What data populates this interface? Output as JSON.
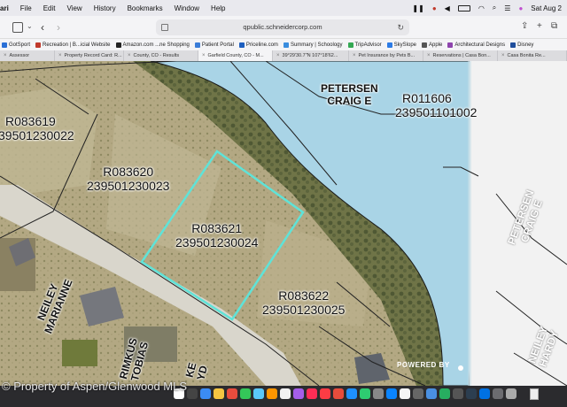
{
  "menubar": {
    "app": "ari",
    "items": [
      "File",
      "Edit",
      "View",
      "History",
      "Bookmarks",
      "Window",
      "Help"
    ],
    "clock": "Sat Aug 2"
  },
  "toolbar": {
    "url": "qpublic.schneidercorp.com"
  },
  "bookmarks": [
    {
      "label": "GotSport",
      "color": "#2a6fd6"
    },
    {
      "label": "Recreation | B...icial Website",
      "color": "#c0392b"
    },
    {
      "label": "Amazon.com ...ne Shopping",
      "color": "#222222"
    },
    {
      "label": "Patient Portal",
      "color": "#3b7dd8"
    },
    {
      "label": "Priceline.com",
      "color": "#1d5fbf"
    },
    {
      "label": "Summary | Schoology",
      "color": "#3a8dde"
    },
    {
      "label": "TripAdvisor",
      "color": "#34a853"
    },
    {
      "label": "SkySlope",
      "color": "#2c7be5"
    },
    {
      "label": "Apple",
      "color": "#555555"
    },
    {
      "label": "Architectural Designs",
      "color": "#8e44ad"
    },
    {
      "label": "Disney",
      "color": "#1f4e9c"
    }
  ],
  "tabs": [
    {
      "label": "Assessor"
    },
    {
      "label": "Property Record Card: R..."
    },
    {
      "label": "County, CO - Results"
    },
    {
      "label": "Garfield County, CO - M..."
    },
    {
      "label": "39°29'30.7\"N 107°18'62..."
    },
    {
      "label": "Pet Insurance by Pets B..."
    },
    {
      "label": "Reservations | Casa Bon..."
    },
    {
      "label": "Casa Bonita Re..."
    }
  ],
  "map": {
    "parcels": [
      {
        "id": "R083619",
        "number": "39501230022"
      },
      {
        "id": "R083620",
        "number": "239501230023"
      },
      {
        "id": "R083621",
        "number": "239501230024"
      },
      {
        "id": "R083622",
        "number": "239501230025"
      },
      {
        "id": "R011606",
        "number": "239501101002"
      }
    ],
    "owners": {
      "petersen": "PETERSEN\nCRAIG E",
      "petersen_rotated": "PETERSEN\nCRAIG E",
      "neiley": "NEILEY\nMARIANNE",
      "rimkus": "RIMKUS\nTOBIAS",
      "lyd": "KE\nYD",
      "hardy": "NEILEY\nHARDY"
    },
    "powered_by": "POWERED BY"
  },
  "footer": {
    "copyright": "© Property of Aspen/Glenwood MLS"
  },
  "colors": {
    "river": "#a9d4e6",
    "selected_parcel": "#5fe3d8"
  }
}
